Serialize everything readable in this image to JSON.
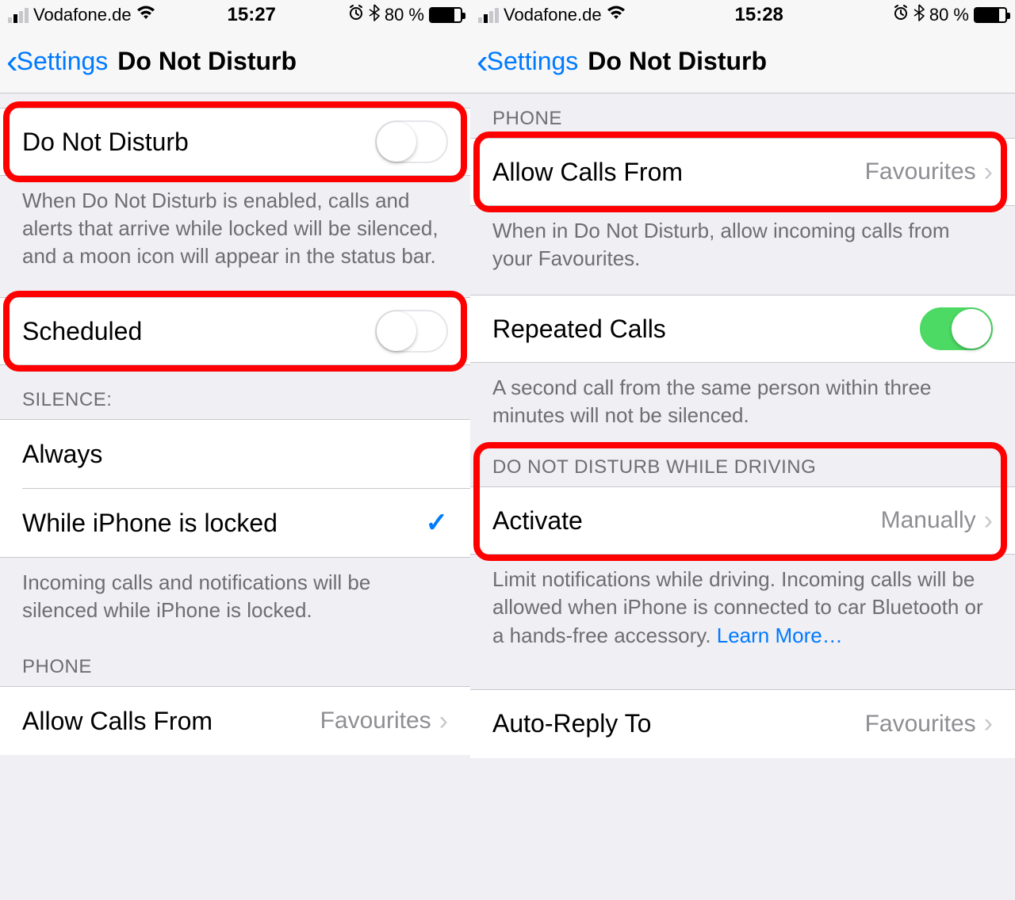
{
  "left": {
    "status": {
      "carrier": "Vodafone.de",
      "time": "15:27",
      "battery": "80 %"
    },
    "nav": {
      "back": "Settings",
      "title": "Do Not Disturb"
    },
    "dnd": {
      "label": "Do Not Disturb"
    },
    "dnd_footer": "When Do Not Disturb is enabled, calls and alerts that arrive while locked will be silenced, and a moon icon will appear in the status bar.",
    "scheduled": {
      "label": "Scheduled"
    },
    "silence_header": "SILENCE:",
    "silence": {
      "always": "Always",
      "locked": "While iPhone is locked"
    },
    "silence_footer": "Incoming calls and notifications will be silenced while iPhone is locked.",
    "phone_header": "PHONE",
    "allow_calls": {
      "label": "Allow Calls From",
      "value": "Favourites"
    }
  },
  "right": {
    "status": {
      "carrier": "Vodafone.de",
      "time": "15:28",
      "battery": "80 %"
    },
    "nav": {
      "back": "Settings",
      "title": "Do Not Disturb"
    },
    "phone_header": "PHONE",
    "allow_calls": {
      "label": "Allow Calls From",
      "value": "Favourites"
    },
    "allow_footer": "When in Do Not Disturb, allow incoming calls from your Favourites.",
    "repeated": {
      "label": "Repeated Calls"
    },
    "repeated_footer": "A second call from the same person within three minutes will not be silenced.",
    "driving_header": "DO NOT DISTURB WHILE DRIVING",
    "activate": {
      "label": "Activate",
      "value": "Manually"
    },
    "driving_footer": "Limit notifications while driving. Incoming calls will be allowed when iPhone is connected to car Bluetooth or a hands-free accessory. ",
    "learn_more": "Learn More…",
    "autoreply": {
      "label": "Auto-Reply To",
      "value": "Favourites"
    }
  }
}
